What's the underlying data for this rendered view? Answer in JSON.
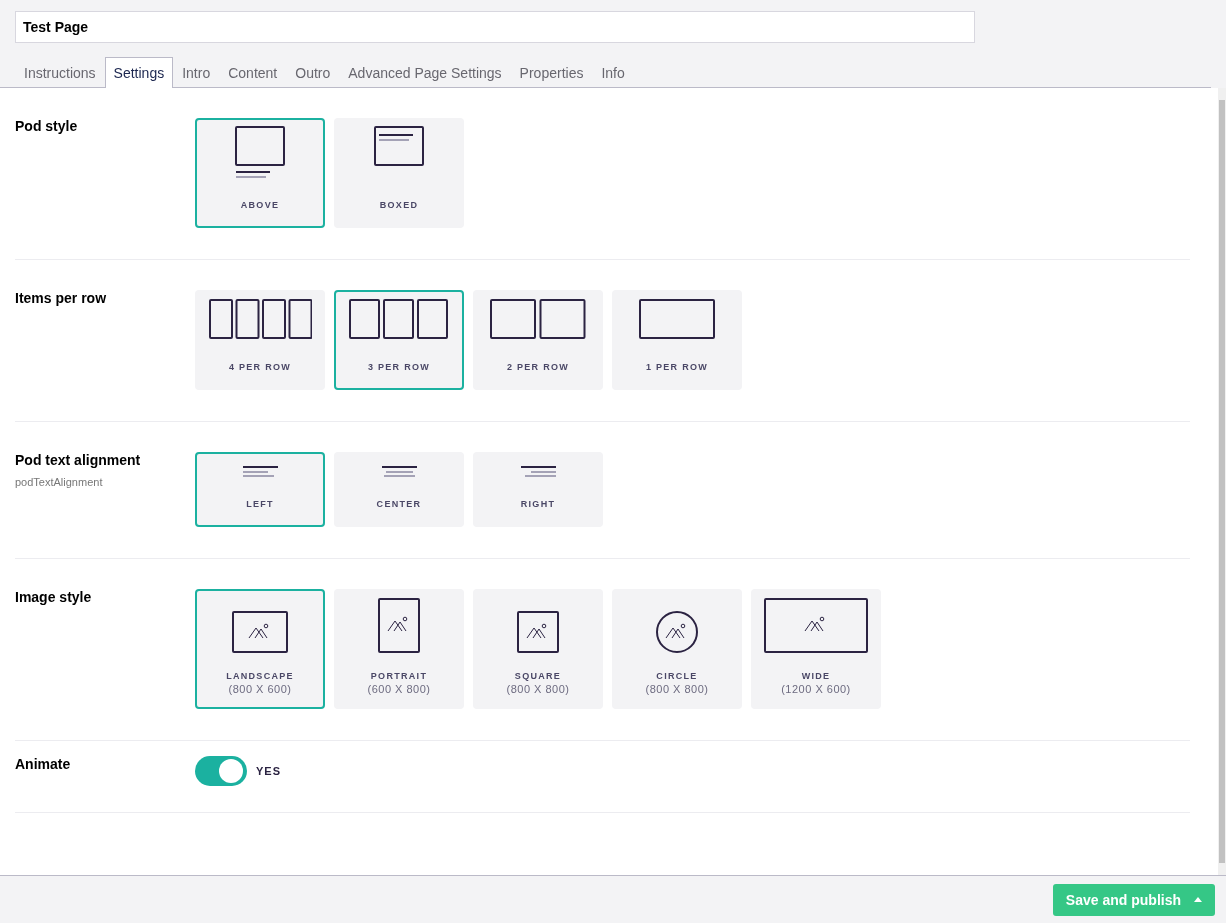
{
  "page_name": {
    "value": "Test Page"
  },
  "tabs": [
    {
      "label": "Instructions",
      "selected": false
    },
    {
      "label": "Settings",
      "selected": true
    },
    {
      "label": "Intro",
      "selected": false
    },
    {
      "label": "Content",
      "selected": false
    },
    {
      "label": "Outro",
      "selected": false
    },
    {
      "label": "Advanced Page Settings",
      "selected": false
    },
    {
      "label": "Properties",
      "selected": false
    },
    {
      "label": "Info",
      "selected": false
    }
  ],
  "sections": [
    {
      "kind": "options",
      "label": "Pod style",
      "options": [
        {
          "kind": "above",
          "label": "ABOVE",
          "selected": true
        },
        {
          "kind": "boxed",
          "label": "BOXED",
          "selected": false
        }
      ]
    },
    {
      "kind": "options",
      "label": "Items per row",
      "options": [
        {
          "kind": "cols4",
          "label": "4 PER ROW",
          "selected": false
        },
        {
          "kind": "cols3",
          "label": "3 PER ROW",
          "selected": true
        },
        {
          "kind": "cols2",
          "label": "2 PER ROW",
          "selected": false
        },
        {
          "kind": "cols1",
          "label": "1 PER ROW",
          "selected": false
        }
      ]
    },
    {
      "kind": "options",
      "label": "Pod text alignment",
      "alias": "podTextAlignment",
      "options": [
        {
          "kind": "align-left",
          "label": "LEFT",
          "selected": true
        },
        {
          "kind": "align-center",
          "label": "CENTER",
          "selected": false
        },
        {
          "kind": "align-right",
          "label": "RIGHT",
          "selected": false
        }
      ]
    },
    {
      "kind": "options",
      "label": "Image style",
      "options": [
        {
          "kind": "landscape",
          "label": "LANDSCAPE",
          "size": "(800 X 600)",
          "selected": true
        },
        {
          "kind": "portrait",
          "label": "PORTRAIT",
          "size": "(600 X 800)",
          "selected": false
        },
        {
          "kind": "square",
          "label": "SQUARE",
          "size": "(800 X 800)",
          "selected": false
        },
        {
          "kind": "circle",
          "label": "CIRCLE",
          "size": "(800 X 800)",
          "selected": false
        },
        {
          "kind": "wide",
          "label": "WIDE",
          "size": "(1200 X 600)",
          "selected": false
        }
      ]
    },
    {
      "kind": "toggle",
      "label": "Animate",
      "on": true,
      "value": "YES"
    }
  ],
  "footer": {
    "button": "Save and publish"
  }
}
